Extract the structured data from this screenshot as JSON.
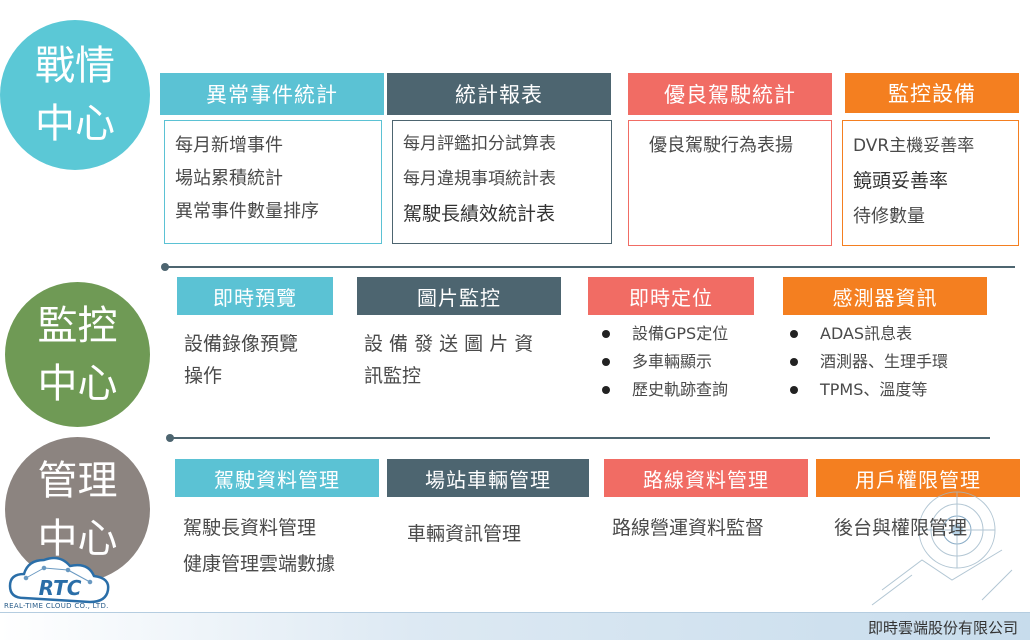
{
  "sections": {
    "war_room": {
      "title_line1": "戰情",
      "title_line2": "中心",
      "headers": [
        "異常事件統計",
        "統計報表",
        "優良駕駛統計",
        "監控設備"
      ],
      "box1": [
        "每月新增事件",
        "場站累積統計",
        "異常事件數量排序"
      ],
      "box2": [
        "每月評鑑扣分試算表",
        "每月違規事項統計表",
        "駕駛長績效統計表"
      ],
      "box3": [
        "優良駕駛行為表揚"
      ],
      "box4": [
        "DVR主機妥善率",
        "鏡頭妥善率",
        "待修數量"
      ]
    },
    "monitor": {
      "title_line1": "監控",
      "title_line2": "中心",
      "headers": [
        "即時預覽",
        "圖片監控",
        "即時定位",
        "感測器資訊"
      ],
      "col1": [
        "設備錄像預覽",
        "操作"
      ],
      "col2": [
        "設 備 發 送 圖 片 資",
        "訊監控"
      ],
      "col3": [
        "設備GPS定位",
        "多車輛顯示",
        "歷史軌跡查詢"
      ],
      "col4": [
        "ADAS訊息表",
        "酒測器、生理手環",
        "TPMS、溫度等"
      ]
    },
    "manage": {
      "title_line1": "管理",
      "title_line2": "中心",
      "headers": [
        "駕駛資料管理",
        "場站車輛管理",
        "路線資料管理",
        "用戶權限管理"
      ],
      "col1": [
        "駕駛長資料管理",
        "健康管理雲端數據"
      ],
      "col2": [
        "車輛資訊管理"
      ],
      "col3": [
        "路線營運資料監督"
      ],
      "col4": [
        "後台與權限管理"
      ]
    }
  },
  "logo": {
    "text": "RTC",
    "subtitle": "REAL-TIME CLOUD CO., LTD."
  },
  "footer": {
    "company": "即時雲端股份有限公司"
  },
  "colors": {
    "teal": "#5bc2d4",
    "slate": "#4d6570",
    "salmon": "#f16c64",
    "orange": "#f47f20"
  }
}
